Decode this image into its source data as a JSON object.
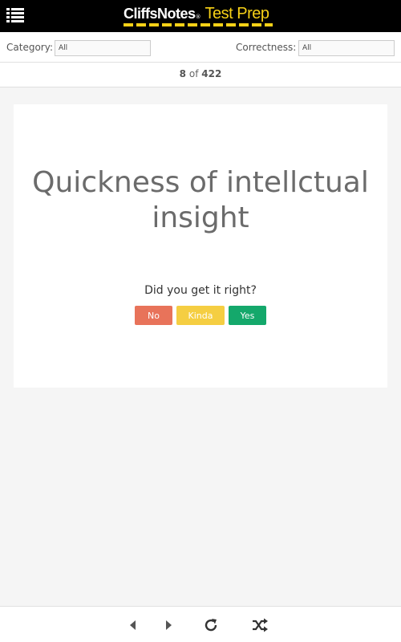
{
  "header": {
    "brand_primary": "CliffsNotes",
    "brand_reg": "®",
    "brand_secondary": "Test Prep",
    "menu_icon": "hamburger-list-icon",
    "accent_color": "#f7d117"
  },
  "filters": {
    "category_label": "Category:",
    "category_value": "All",
    "correctness_label": "Correctness:",
    "correctness_value": "All"
  },
  "counter": {
    "current": "8",
    "of_text": "of",
    "total": "422"
  },
  "card": {
    "term": "Quickness of intellctual insight",
    "question": "Did you get it right?",
    "buttons": {
      "no": "No",
      "kinda": "Kinda",
      "yes": "Yes"
    },
    "colors": {
      "no": "#e8735a",
      "kinda": "#f5ce42",
      "yes": "#14a86b"
    }
  },
  "footer": {
    "icons": [
      "previous-icon",
      "next-icon",
      "reload-icon",
      "shuffle-icon"
    ]
  }
}
